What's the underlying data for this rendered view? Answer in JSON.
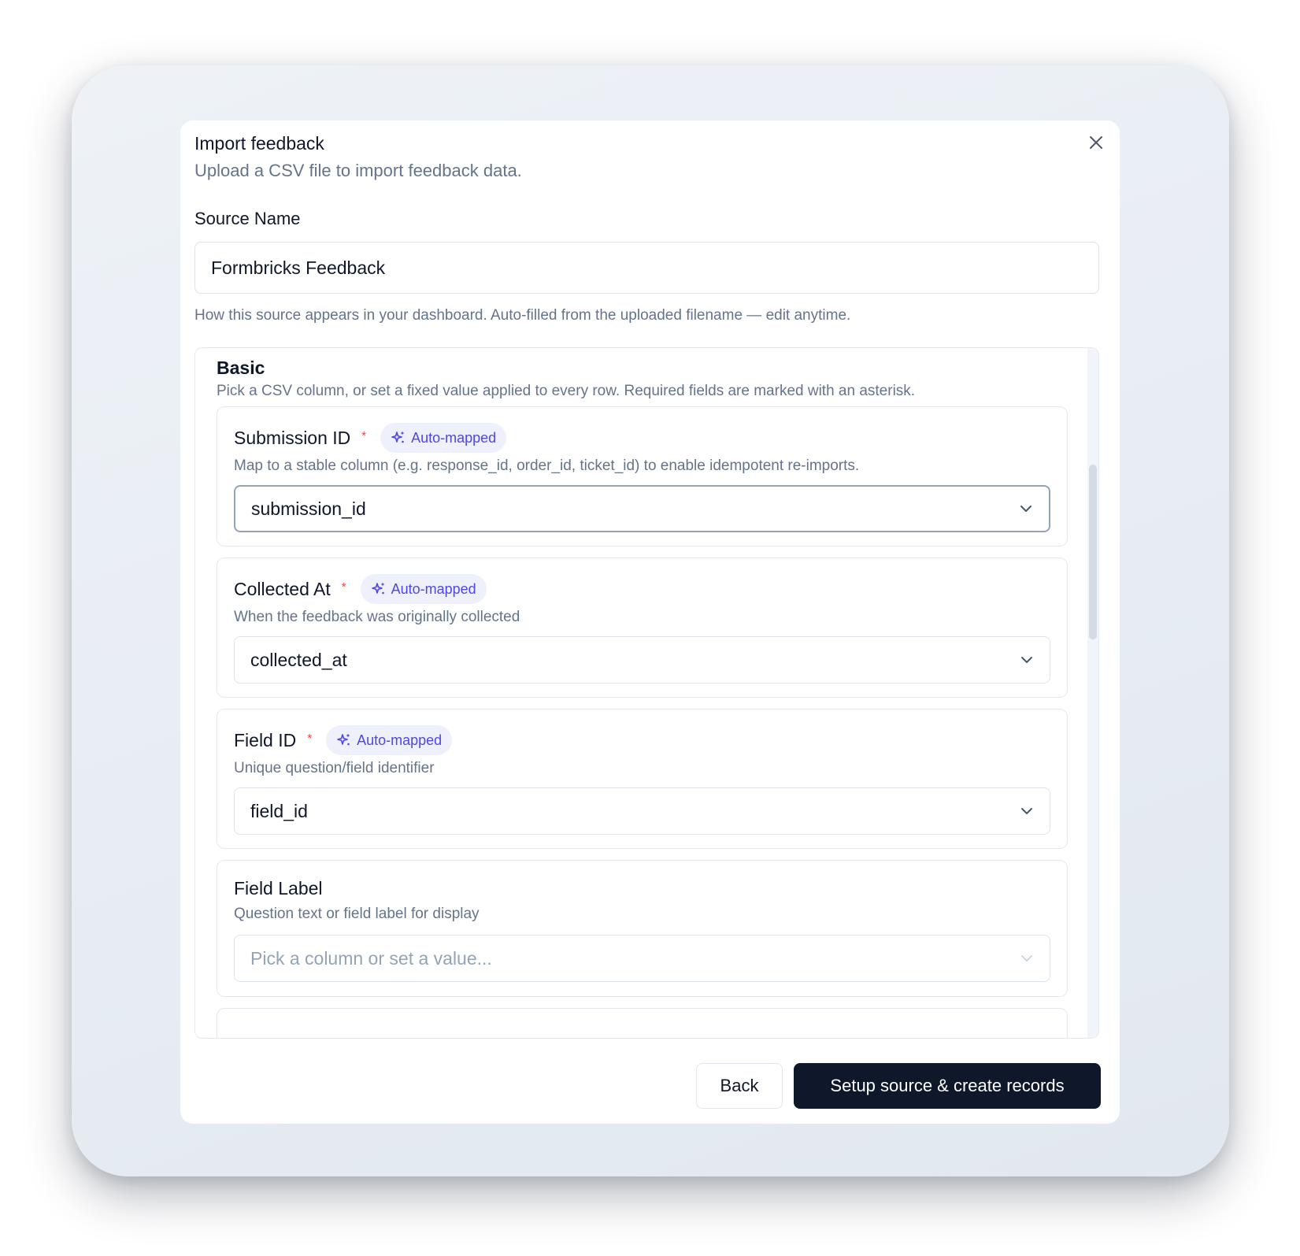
{
  "dialog": {
    "title": "Import feedback",
    "subtitle": "Upload a CSV file to import feedback data.",
    "close_icon": "close-icon"
  },
  "source": {
    "label": "Source Name",
    "value": "Formbricks Feedback",
    "help": "How this source appears in your dashboard. Auto-filled from the uploaded filename — edit anytime."
  },
  "section": {
    "title": "Basic",
    "description": "Pick a CSV column, or set a fixed value applied to every row. Required fields are marked with an asterisk."
  },
  "fields": [
    {
      "label": "Submission ID",
      "required_mark": "*",
      "badge": "Auto-mapped",
      "description": "Map to a stable column (e.g. response_id, order_id, ticket_id) to enable idempotent re-imports.",
      "value": "submission_id"
    },
    {
      "label": "Collected At",
      "required_mark": "*",
      "badge": "Auto-mapped",
      "description": "When the feedback was originally collected",
      "value": "collected_at"
    },
    {
      "label": "Field ID",
      "required_mark": "*",
      "badge": "Auto-mapped",
      "description": "Unique question/field identifier",
      "value": "field_id"
    },
    {
      "label": "Field Label",
      "description": "Question text or field label for display",
      "placeholder": "Pick a column or set a value..."
    }
  ],
  "footer": {
    "back_label": "Back",
    "submit_label": "Setup source & create records"
  },
  "colors": {
    "accent": "#4f46e5",
    "badge_bg": "#eef0fb",
    "required": "#ef4444",
    "primary_button": "#0f172a",
    "muted_text": "#64748b"
  }
}
